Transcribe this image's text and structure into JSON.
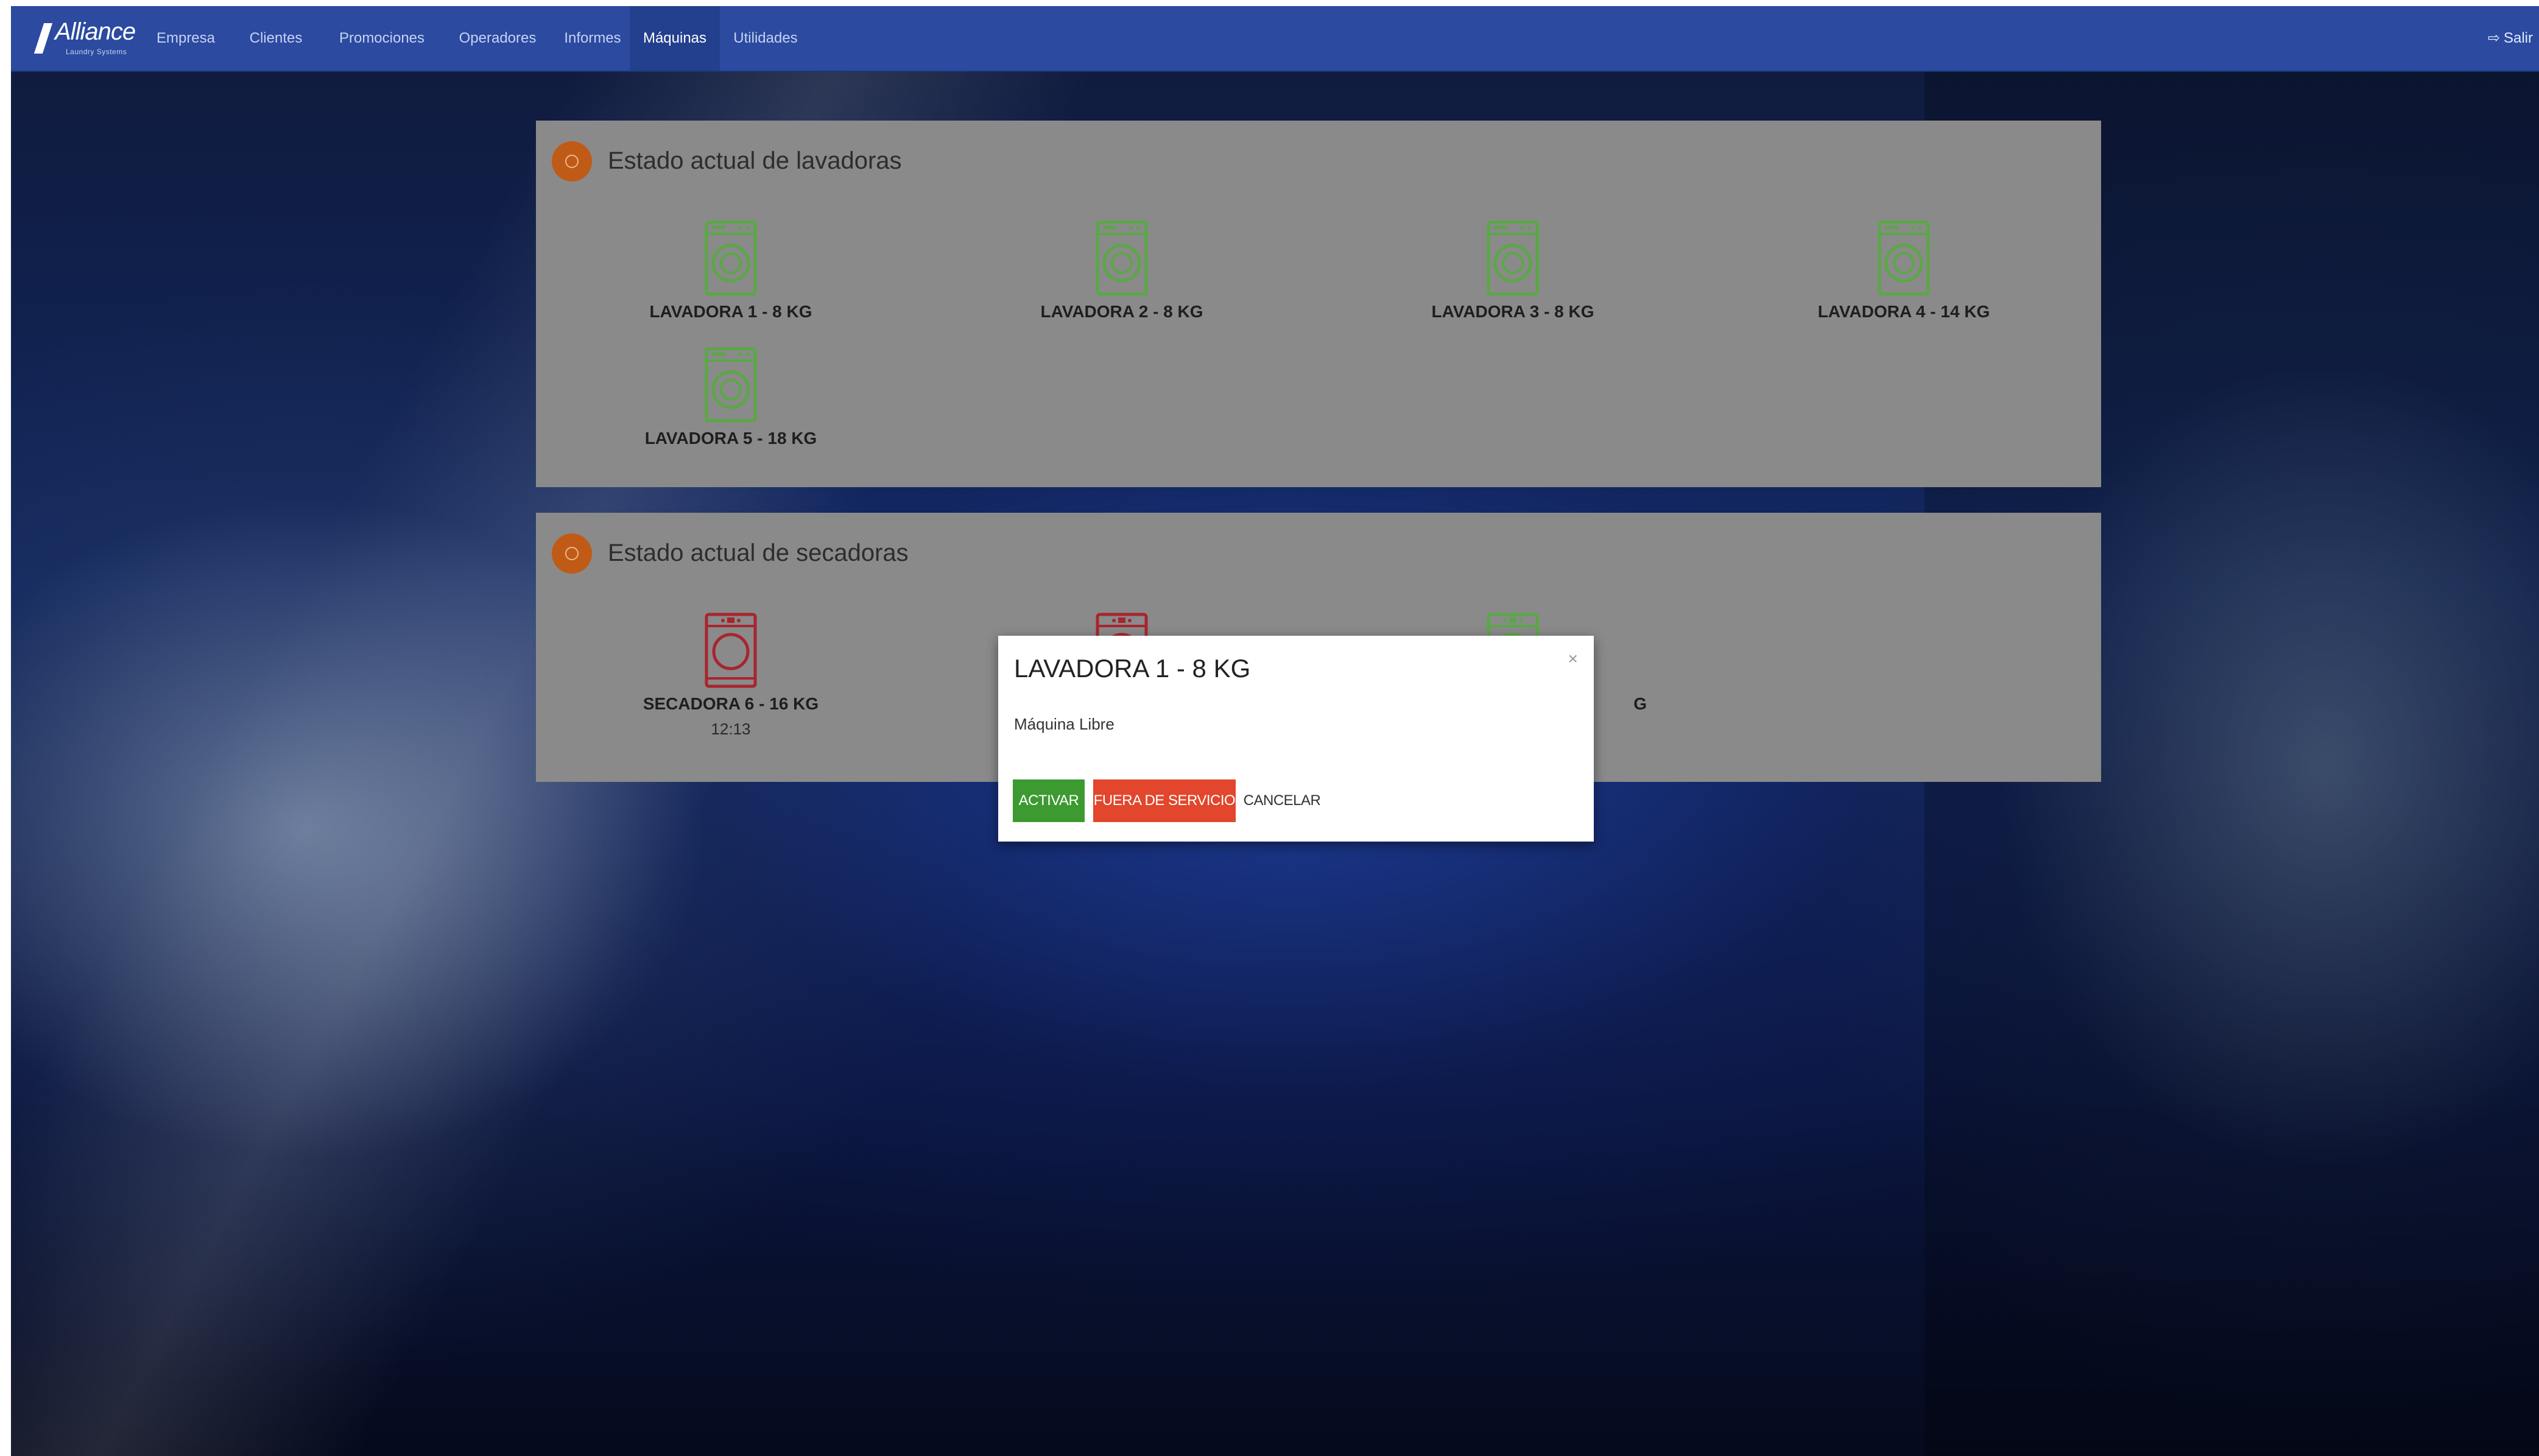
{
  "navbar": {
    "brand": {
      "name": "Alliance",
      "subtitle": "Laundry Systems"
    },
    "items": [
      {
        "label": "Empresa"
      },
      {
        "label": "Clientes"
      },
      {
        "label": "Promociones"
      },
      {
        "label": "Operadores"
      },
      {
        "label": "Informes"
      },
      {
        "label": "Máquinas",
        "active": true
      },
      {
        "label": "Utilidades"
      }
    ],
    "logout_label": "Salir",
    "logout_icon": "sign-out-icon"
  },
  "washers": {
    "title": "Estado actual de lavadoras",
    "machines": [
      {
        "label": "LAVADORA 1 - 8 KG",
        "status_color": "#5aa845"
      },
      {
        "label": "LAVADORA 2 - 8 KG",
        "status_color": "#5aa845"
      },
      {
        "label": "LAVADORA 3 - 8 KG",
        "status_color": "#5aa845"
      },
      {
        "label": "LAVADORA 4 - 14 KG",
        "status_color": "#5aa845"
      },
      {
        "label": "LAVADORA 5 - 18 KG",
        "status_color": "#5aa845"
      }
    ]
  },
  "dryers": {
    "title": "Estado actual de secadoras",
    "machines": [
      {
        "label": "SECADORA 6 - 16 KG",
        "time": "12:13",
        "status_color": "#a8252d"
      },
      {
        "label": "",
        "status_color": "#a8252d"
      },
      {
        "label": "G",
        "status_color": "#5aa845"
      }
    ]
  },
  "modal": {
    "title": "LAVADORA 1 - 8 KG",
    "close": "×",
    "status": "Máquina Libre",
    "buttons": {
      "activate": "ACTIVAR",
      "out_of_service": "FUERA DE SERVICIO",
      "cancel": "CANCELAR"
    },
    "colors": {
      "activate": "#3c9a30",
      "out_of_service": "#e2462c"
    }
  }
}
